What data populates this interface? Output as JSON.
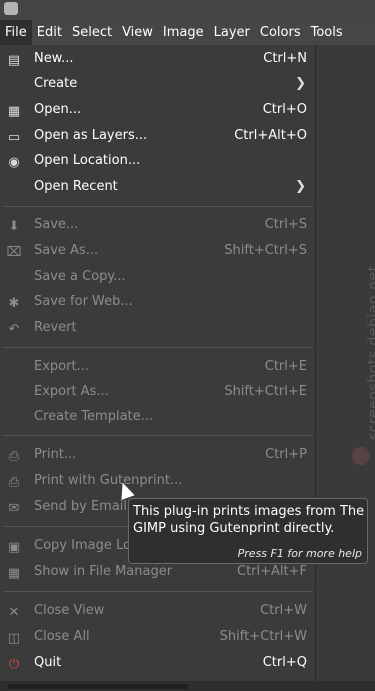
{
  "menubar": {
    "items": [
      "File",
      "Edit",
      "Select",
      "View",
      "Image",
      "Layer",
      "Colors",
      "Tools"
    ]
  },
  "file_menu": {
    "items": [
      {
        "label": "New...",
        "shortcut": "Ctrl+N",
        "icon": "new-image-icon",
        "enabled": true
      },
      {
        "label": "Create",
        "shortcut": "",
        "submenu": true,
        "enabled": true
      },
      {
        "label": "Open...",
        "shortcut": "Ctrl+O",
        "icon": "open-icon",
        "enabled": true
      },
      {
        "label": "Open as Layers...",
        "shortcut": "Ctrl+Alt+O",
        "icon": "open-as-layers-icon",
        "enabled": true
      },
      {
        "label": "Open Location...",
        "shortcut": "",
        "icon": "globe-icon",
        "enabled": true
      },
      {
        "label": "Open Recent",
        "shortcut": "",
        "submenu": true,
        "enabled": true
      },
      {
        "label": "Save...",
        "shortcut": "Ctrl+S",
        "icon": "save-icon",
        "enabled": false
      },
      {
        "label": "Save As...",
        "shortcut": "Shift+Ctrl+S",
        "icon": "save-as-icon",
        "enabled": false
      },
      {
        "label": "Save a Copy...",
        "shortcut": "",
        "enabled": false
      },
      {
        "label": "Save for Web...",
        "shortcut": "",
        "icon": "save-web-icon",
        "enabled": false
      },
      {
        "label": "Revert",
        "shortcut": "",
        "icon": "revert-icon",
        "enabled": false
      },
      {
        "label": "Export...",
        "shortcut": "Ctrl+E",
        "enabled": false
      },
      {
        "label": "Export As...",
        "shortcut": "Shift+Ctrl+E",
        "enabled": false
      },
      {
        "label": "Create Template...",
        "shortcut": "",
        "enabled": false
      },
      {
        "label": "Print...",
        "shortcut": "Ctrl+P",
        "icon": "print-icon",
        "enabled": false
      },
      {
        "label": "Print with Gutenprint...",
        "shortcut": "",
        "icon": "gutenprint-icon",
        "enabled": false
      },
      {
        "label": "Send by Email...",
        "shortcut": "",
        "icon": "email-icon",
        "enabled": false
      },
      {
        "label": "Copy Image Location",
        "shortcut": "",
        "icon": "copy-location-icon",
        "enabled": false
      },
      {
        "label": "Show in File Manager",
        "shortcut": "Ctrl+Alt+F",
        "icon": "file-manager-icon",
        "enabled": false
      },
      {
        "label": "Close View",
        "shortcut": "Ctrl+W",
        "icon": "close-icon",
        "enabled": false
      },
      {
        "label": "Close All",
        "shortcut": "Shift+Ctrl+W",
        "icon": "close-all-icon",
        "enabled": false
      },
      {
        "label": "Quit",
        "shortcut": "Ctrl+Q",
        "icon": "quit-icon",
        "enabled": true
      }
    ]
  },
  "tooltip": {
    "text": "This plug-in prints images from The GIMP using Gutenprint directly.",
    "help": "Press F1 for more help"
  },
  "watermark": "screenshots.debian.net"
}
